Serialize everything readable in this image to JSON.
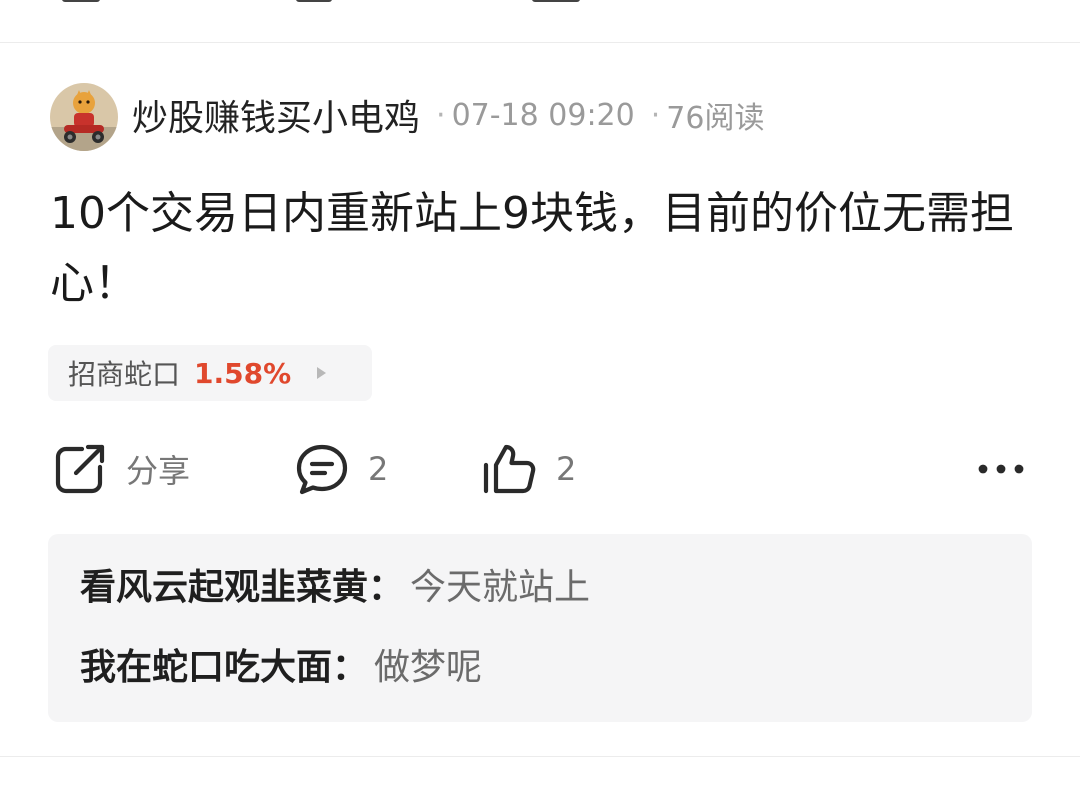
{
  "post": {
    "author": "炒股赚钱买小电鸡",
    "date": "07-18 09:20",
    "reads": "76阅读",
    "title": "10个交易日内重新站上9块钱，目前的价位无需担心！",
    "stock": {
      "name": "招商蛇口",
      "change": "1.58%",
      "change_color": "#e0482d"
    }
  },
  "actions": {
    "share_label": "分享",
    "comment_count": "2",
    "like_count": "2"
  },
  "comments": [
    {
      "user": "看风云起观韭菜黄",
      "text": "今天就站上"
    },
    {
      "user": "我在蛇口吃大面",
      "text": "做梦呢"
    }
  ],
  "icons": {
    "share": "share-icon",
    "comment": "comment-icon",
    "like": "thumbs-up-icon",
    "more": "more-icon",
    "chip_arrow": "triangle-right-icon"
  }
}
